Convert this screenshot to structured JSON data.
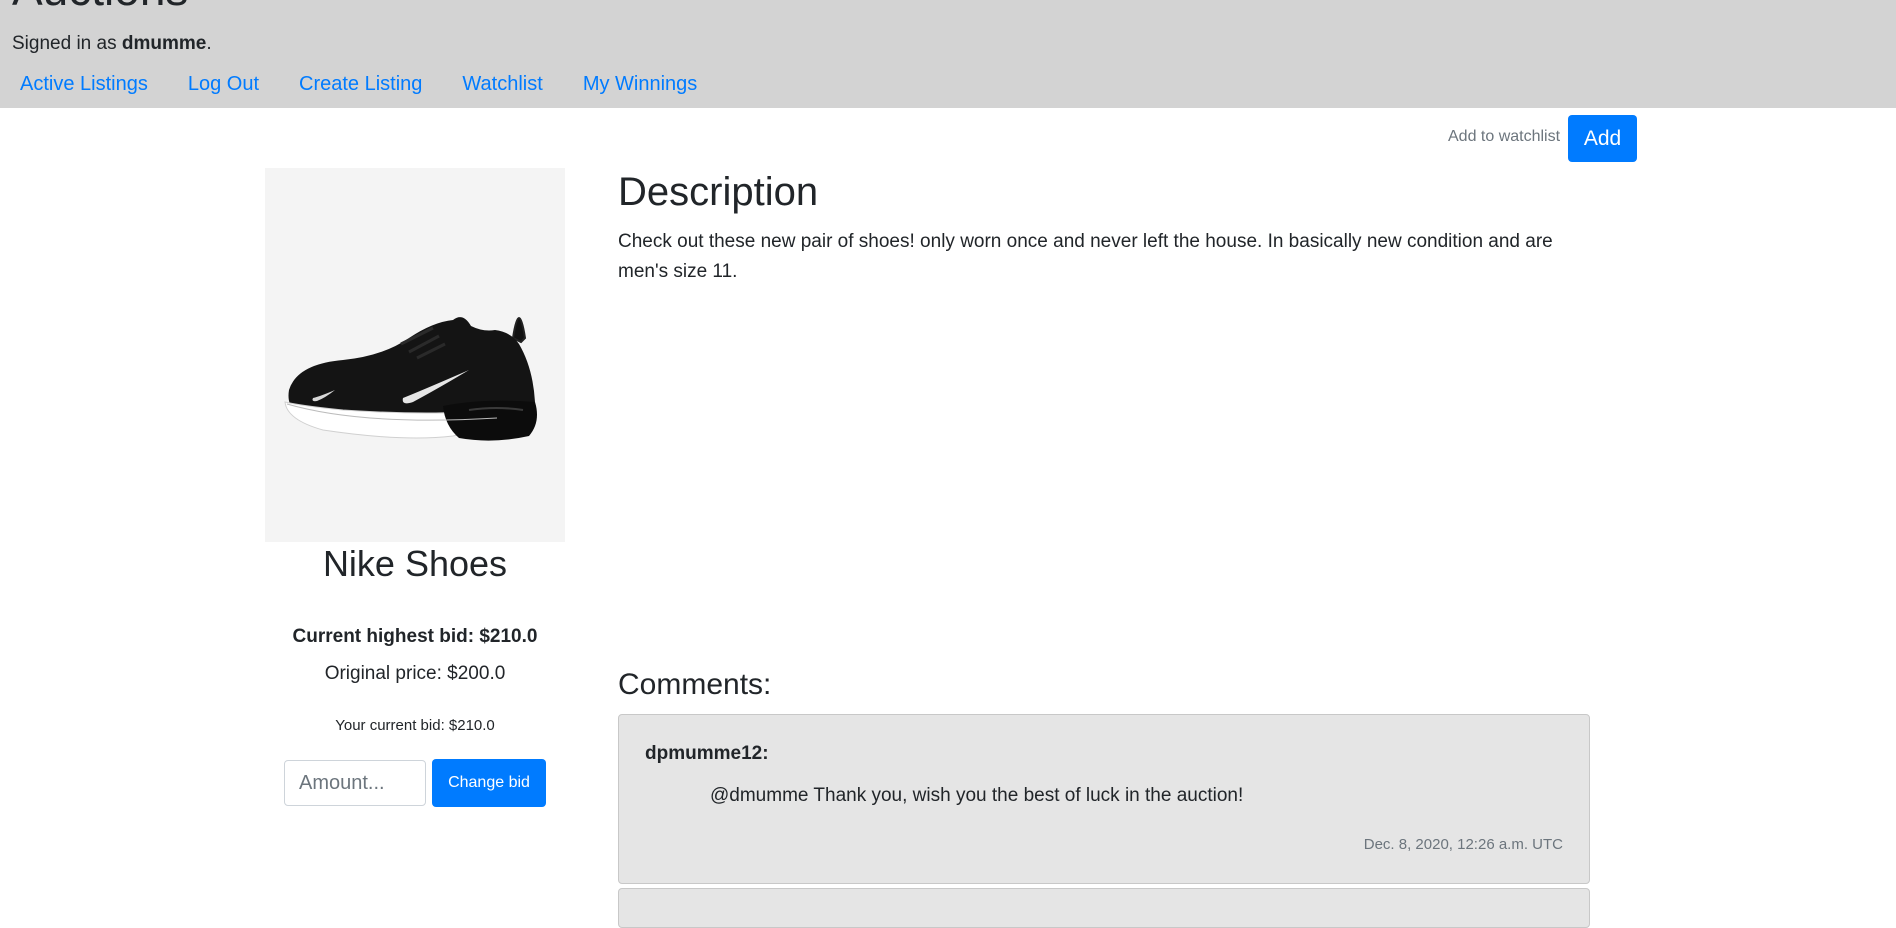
{
  "header": {
    "site_title": "Auctions",
    "signed_in_prefix": "Signed in as ",
    "username": "dmumme",
    "signed_in_suffix": ".",
    "nav": [
      {
        "label": "Active Listings"
      },
      {
        "label": "Log Out"
      },
      {
        "label": "Create Listing"
      },
      {
        "label": "Watchlist"
      },
      {
        "label": "My Winnings"
      }
    ]
  },
  "watchlist": {
    "label": "Add to watchlist",
    "button": "Add"
  },
  "listing": {
    "image_icon": "sneaker-image",
    "title": "Nike Shoes",
    "highest_bid": "Current highest bid: $210.0",
    "original_price": "Original price: $200.0",
    "your_bid": "Your current bid: $210.0",
    "amount_placeholder": "Amount...",
    "change_bid_label": "Change bid"
  },
  "description": {
    "heading": "Description",
    "text": "Check out these new pair of shoes! only worn once and never left the house. In basically new condition and are men's size 11."
  },
  "comments": {
    "heading": "Comments:",
    "items": [
      {
        "author": "dpmumme12:",
        "body": "@dmumme Thank you, wish you the best of luck in the auction!",
        "timestamp": "Dec. 8, 2020, 12:26 a.m. UTC"
      }
    ]
  },
  "colors": {
    "header_bg": "#d3d3d3",
    "link": "#007bff",
    "primary_button": "#007bff",
    "comment_bg": "#e5e5e5"
  }
}
